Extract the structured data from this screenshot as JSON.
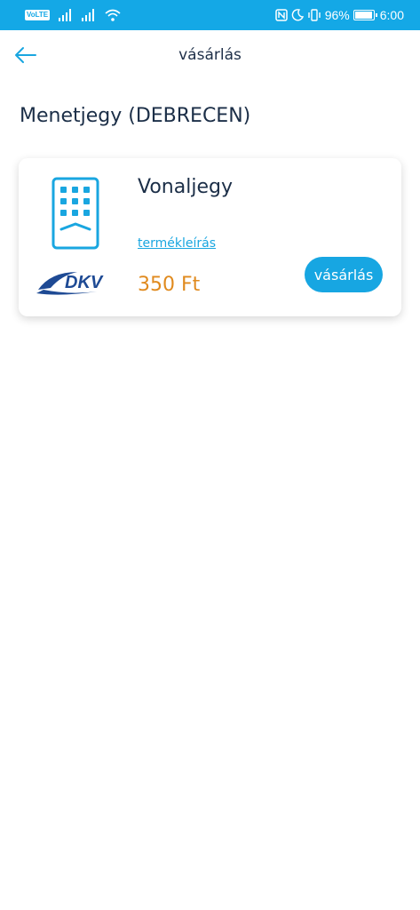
{
  "status_bar": {
    "volte": "VoLTE",
    "battery_percent": "96%",
    "time": "6:00"
  },
  "header": {
    "title": "vásárlás"
  },
  "page": {
    "title": "Menetjegy (DEBRECEN)"
  },
  "product": {
    "name": "Vonaljegy",
    "description_link": "termékleírás",
    "price": "350 Ft",
    "buy_label": "vásárlás",
    "logo_text": "DKV"
  },
  "colors": {
    "accent": "#14a8e6",
    "price": "#e08a1e",
    "text": "#1b2e47"
  }
}
